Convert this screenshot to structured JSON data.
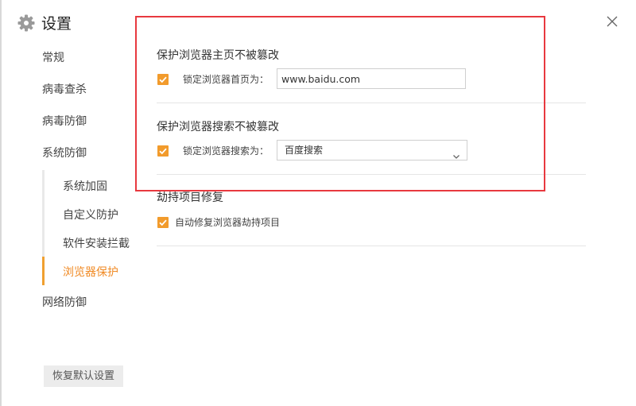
{
  "window": {
    "title": "设置"
  },
  "sidebar": {
    "items": [
      {
        "label": "常规"
      },
      {
        "label": "病毒查杀"
      },
      {
        "label": "病毒防御"
      },
      {
        "label": "系统防御"
      },
      {
        "label": "网络防御"
      }
    ],
    "sub_items": [
      {
        "label": "系统加固"
      },
      {
        "label": "自定义防护"
      },
      {
        "label": "软件安装拦截"
      },
      {
        "label": "浏览器保护",
        "active": true
      }
    ],
    "restore_button": "恢复默认设置"
  },
  "main": {
    "homepage_section": {
      "title": "保护浏览器主页不被篡改",
      "checkbox_label": "锁定浏览器首页为：",
      "checked": true,
      "value": "www.baidu.com"
    },
    "search_section": {
      "title": "保护浏览器搜索不被篡改",
      "checkbox_label": "锁定浏览器搜索为：",
      "checked": true,
      "selected": "百度搜索"
    },
    "hijack_section": {
      "title": "劫持项目修复",
      "checkbox_label": "自动修复浏览器劫持项目",
      "checked": true
    }
  },
  "colors": {
    "accent": "#f29b2c",
    "active_text": "#f08a24",
    "highlight_border": "#e8393f"
  },
  "icons": {
    "title": "gear-icon",
    "close": "close-icon",
    "checkbox": "checkmark-icon",
    "dropdown": "chevron-down-icon"
  }
}
